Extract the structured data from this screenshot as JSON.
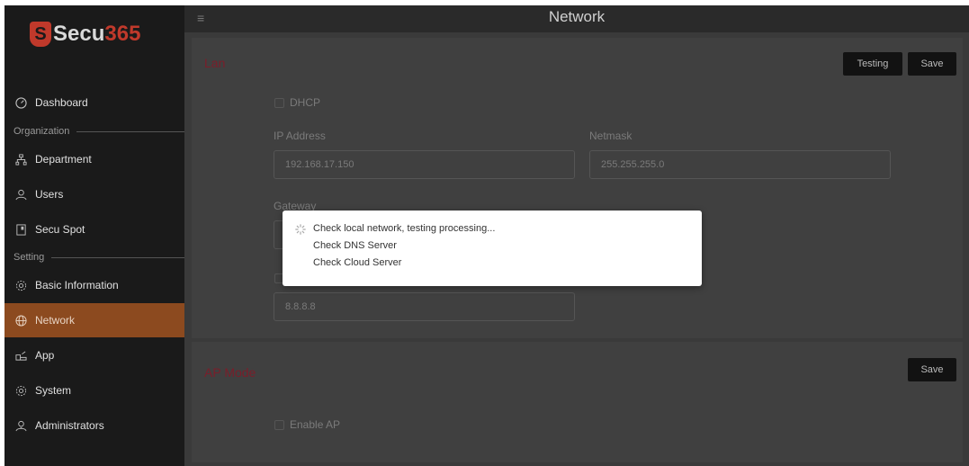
{
  "brand": {
    "badge": "S",
    "secu": "Secu",
    "num": "365"
  },
  "sidebar": {
    "items": [
      {
        "label": "Dashboard",
        "icon": "dashboard-icon"
      },
      {
        "label": "Department",
        "icon": "org-icon"
      },
      {
        "label": "Users",
        "icon": "user-icon"
      },
      {
        "label": "Secu Spot",
        "icon": "device-icon"
      },
      {
        "label": "Basic Information",
        "icon": "gear-icon"
      },
      {
        "label": "Network",
        "icon": "globe-icon",
        "active": true
      },
      {
        "label": "App",
        "icon": "app-icon"
      },
      {
        "label": "System",
        "icon": "gear-icon"
      },
      {
        "label": "Administrators",
        "icon": "admin-icon"
      }
    ],
    "sections": {
      "organization": "Organization",
      "setting": "Setting"
    }
  },
  "header": {
    "title": "Network",
    "menu_icon": "≡"
  },
  "lan": {
    "title": "Lan",
    "testing_label": "Testing",
    "save_label": "Save",
    "dhcp_label": "DHCP",
    "ip_label": "IP Address",
    "ip_value": "192.168.17.150",
    "netmask_label": "Netmask",
    "netmask_value": "255.255.255.0",
    "gateway_label": "Gateway",
    "dns_value": "8.8.8.8"
  },
  "ap": {
    "title": "AP Mode",
    "save_label": "Save",
    "enable_label": "Enable AP"
  },
  "modal": {
    "line1": "Check local network, testing processing...",
    "line2": "Check DNS Server",
    "line3": "Check Cloud Server"
  },
  "colors": {
    "accent": "#c0392b",
    "active_nav": "#8c4a1f",
    "title_red": "#7a1e2a"
  }
}
